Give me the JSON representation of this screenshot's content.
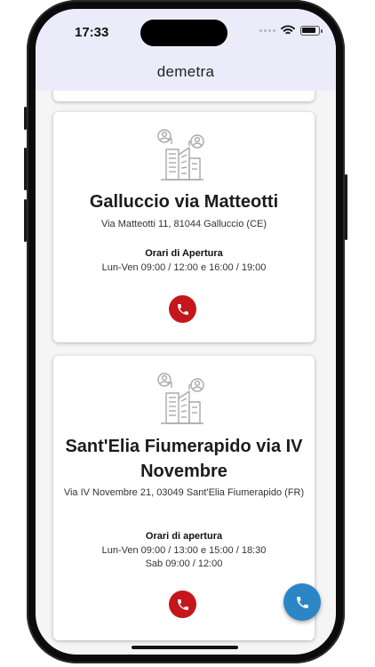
{
  "status_bar": {
    "time": "17:33"
  },
  "header": {
    "title": "demetra"
  },
  "locations": [
    {
      "name": "Galluccio via Matteotti",
      "address": "Via Matteotti 11, 81044 Galluccio (CE)",
      "hours_label": "Orari di Apertura",
      "hours": [
        "Lun-Ven 09:00 / 12:00 e 16:00 / 19:00"
      ]
    },
    {
      "name": "Sant'Elia Fiumerapido via IV Novembre",
      "address": "Via IV Novembre 21, 03049 Sant'Elia Fiumerapido (FR)",
      "hours_label": "Orari di apertura",
      "hours": [
        "Lun-Ven 09:00 / 13:00 e 15:00 / 18:30",
        "Sab 09:00 / 12:00"
      ]
    }
  ],
  "icons": {
    "building": "building-people-icon",
    "call": "phone-icon",
    "fab": "phone-icon"
  },
  "colors": {
    "header_bg": "#ecebfa",
    "call_button": "#c4161c",
    "fab": "#2b86c6"
  }
}
